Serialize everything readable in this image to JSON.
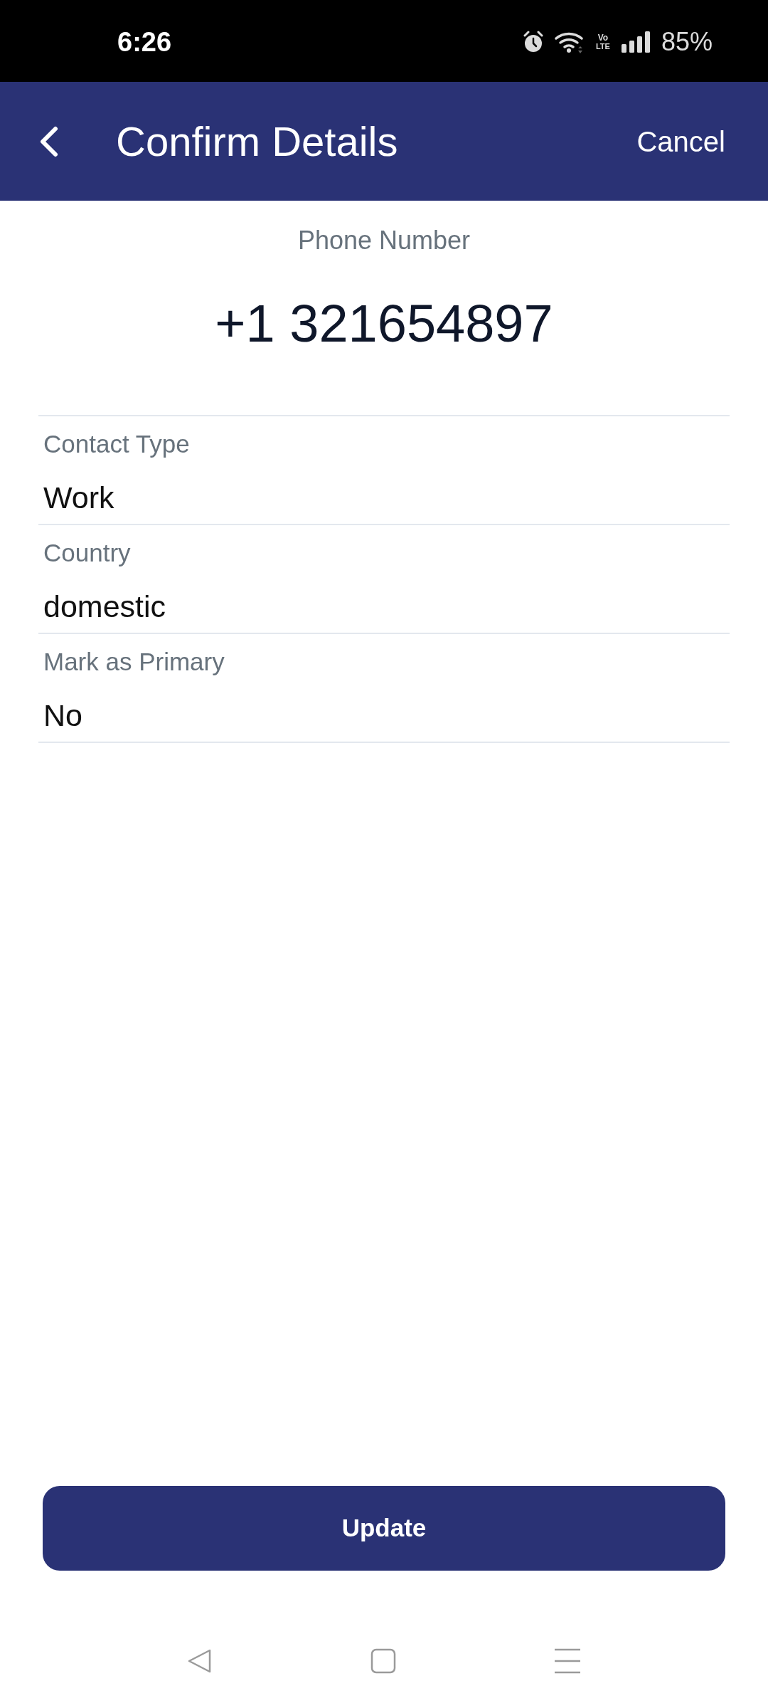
{
  "status_bar": {
    "time": "6:26",
    "volte": {
      "top": "Vo",
      "bottom": "LTE"
    },
    "battery": "85%"
  },
  "header": {
    "title": "Confirm Details",
    "action": "Cancel"
  },
  "phone": {
    "label": "Phone Number",
    "value": "+1 321654897"
  },
  "fields": [
    {
      "label": "Contact Type",
      "value": "Work"
    },
    {
      "label": "Country",
      "value": "domestic"
    },
    {
      "label": "Mark as Primary",
      "value": "No"
    }
  ],
  "button": {
    "label": "Update"
  }
}
